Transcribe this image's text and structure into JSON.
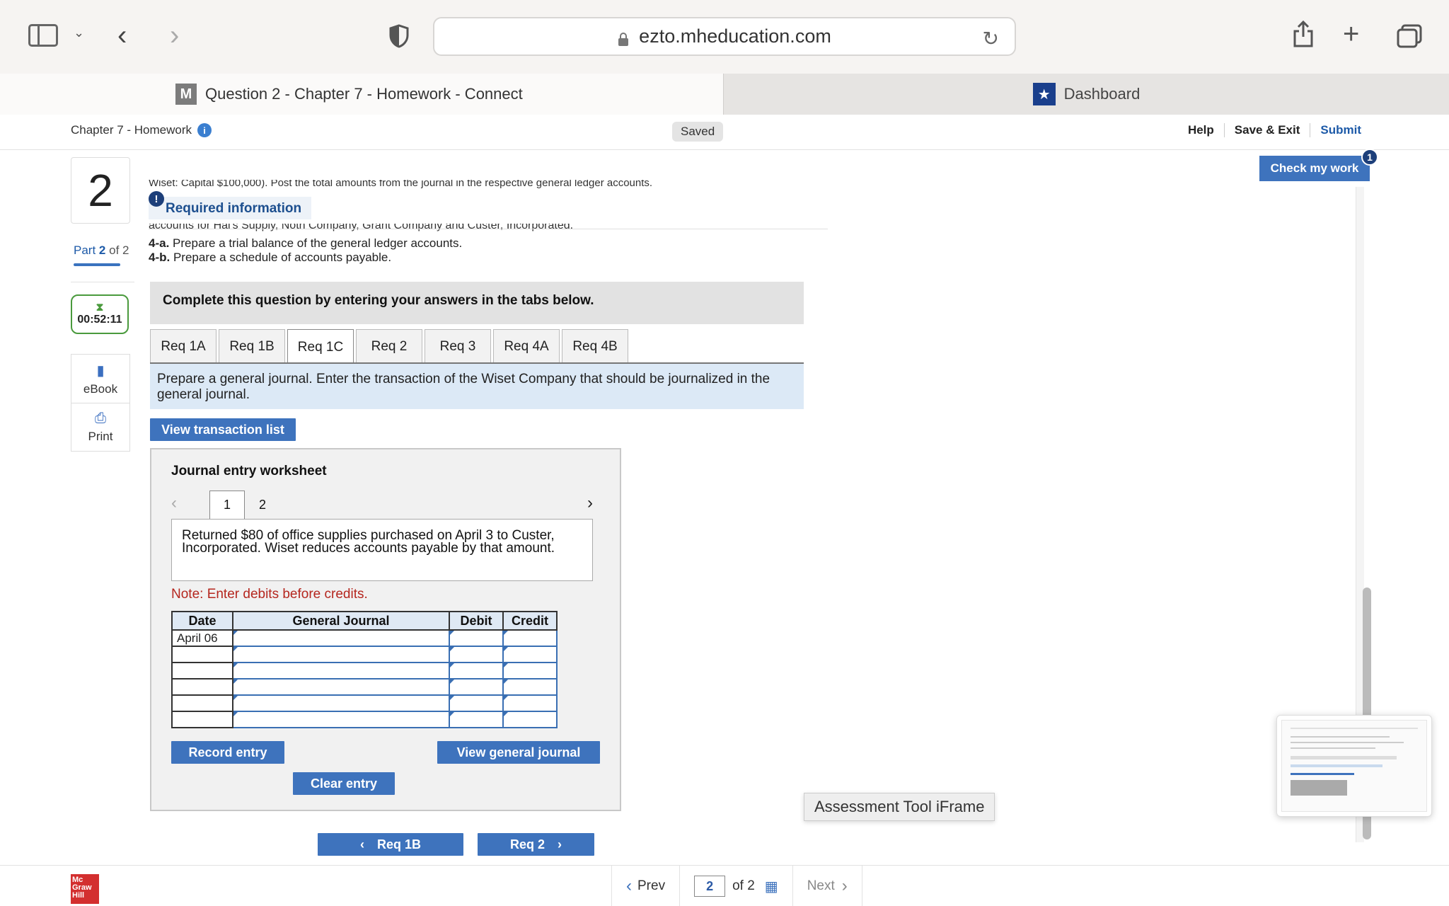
{
  "browser": {
    "url": "ezto.mheducation.com",
    "tabs": [
      {
        "label": "Question 2 - Chapter 7 - Homework - Connect",
        "badge": "M"
      },
      {
        "label": "Dashboard"
      }
    ]
  },
  "header": {
    "title": "Chapter 7 - Homework",
    "saved": "Saved",
    "links": {
      "help": "Help",
      "save_exit": "Save & Exit",
      "submit": "Submit"
    }
  },
  "rail": {
    "question_number": "2",
    "part_label": "Part",
    "part_num": "2",
    "part_of": "of 2",
    "timer": "00:52:11",
    "ebook": "eBook",
    "print": "Print"
  },
  "content": {
    "clipped_top": "Wiset: Capital $100,000). Post the total amounts from the journal in the respective general ledger accounts.",
    "required_info": "Required information",
    "clipped_2": "accounts for Hal's Supply, Noth Company, Grant Company and Custer, Incorporated.",
    "instr_4a_label": "4-a.",
    "instr_4a": "Prepare a trial balance of the general ledger accounts.",
    "instr_4b_label": "4-b.",
    "instr_4b": "Prepare a schedule of accounts payable.",
    "complete": "Complete this question by entering your answers in the tabs below.",
    "tabs": [
      "Req 1A",
      "Req 1B",
      "Req 1C",
      "Req 2",
      "Req 3",
      "Req 4A",
      "Req 4B"
    ],
    "active_tab": "Req 1C",
    "prepare": "Prepare a general journal. Enter the transaction of the Wiset Company that should be journalized in the general journal.",
    "view_transactions": "View transaction list"
  },
  "worksheet": {
    "title": "Journal entry worksheet",
    "pages": [
      "1",
      "2"
    ],
    "transaction": "Returned $80 of office supplies purchased on April 3 to Custer, Incorporated. Wiset reduces accounts payable by that amount.",
    "note": "Note: Enter debits before credits.",
    "columns": [
      "Date",
      "General Journal",
      "Debit",
      "Credit"
    ],
    "rows": [
      {
        "date": "April 06"
      },
      {
        "date": ""
      },
      {
        "date": ""
      },
      {
        "date": ""
      },
      {
        "date": ""
      },
      {
        "date": ""
      }
    ],
    "record": "Record entry",
    "view_gj": "View general journal",
    "clear": "Clear entry"
  },
  "nav": {
    "prev_req": "Req 1B",
    "next_req": "Req 2"
  },
  "check_work": {
    "label": "Check my work",
    "count": "1"
  },
  "iframe_label": "Assessment Tool iFrame",
  "footer": {
    "logo": [
      "Mc",
      "Graw",
      "Hill"
    ],
    "prev": "Prev",
    "page": "2",
    "of": "of 2",
    "next": "Next"
  }
}
